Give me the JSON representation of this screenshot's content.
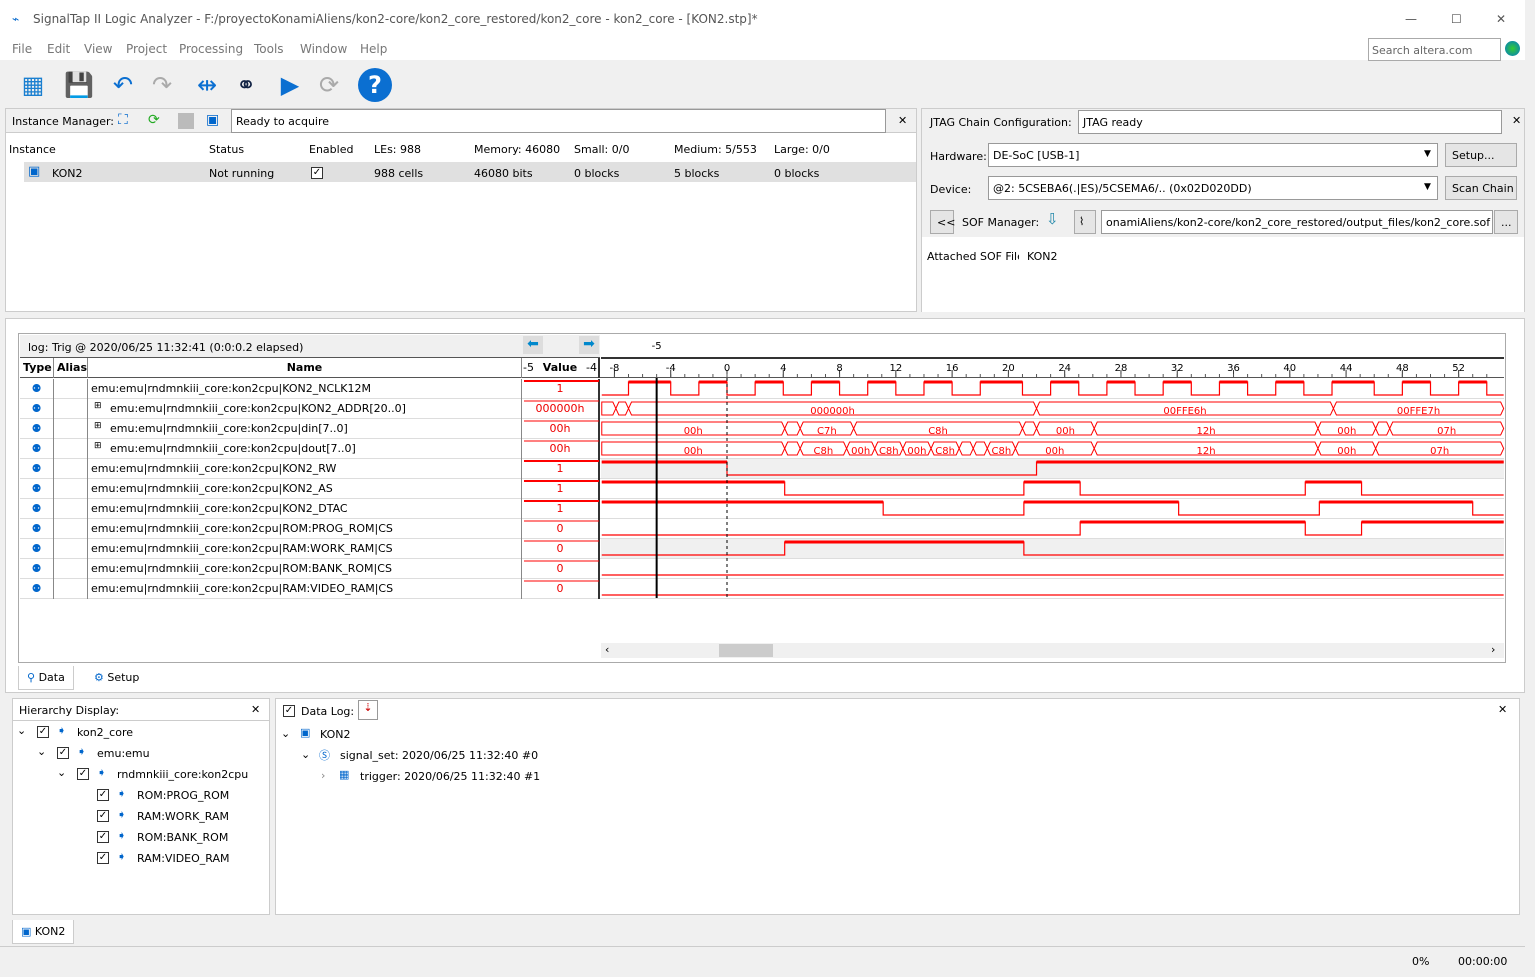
{
  "window": {
    "title": "SignalTap II Logic Analyzer - F:/proyectoKonamiAliens/kon2-core/kon2_core_restored/kon2_core - kon2_core - [KON2.stp]*",
    "minimize": "—",
    "maximize": "☐",
    "close": "✕"
  },
  "menu": [
    "File",
    "Edit",
    "View",
    "Project",
    "Processing",
    "Tools",
    "Window",
    "Help"
  ],
  "search": {
    "placeholder": "Search altera.com"
  },
  "toolbar": [
    "window-icon",
    "save-icon",
    "undo-icon",
    "redo-icon",
    "node-finder-icon",
    "binoculars-icon",
    "run-icon",
    "autorun-icon",
    "help-icon"
  ],
  "instance_manager": {
    "label": "Instance Manager:",
    "status": "Ready to acquire",
    "columns": [
      "Instance",
      "Status",
      "Enabled",
      "LEs: 988",
      "Memory: 46080",
      "Small: 0/0",
      "Medium: 5/553",
      "Large: 0/0"
    ],
    "rows": [
      {
        "instance": "KON2",
        "status": "Not running",
        "enabled": true,
        "les": "988 cells",
        "memory": "46080 bits",
        "small": "0 blocks",
        "medium": "5 blocks",
        "large": "0 blocks"
      }
    ]
  },
  "jtag": {
    "label": "JTAG Chain Configuration:",
    "status": "JTAG ready",
    "hardware_label": "Hardware:",
    "hardware": "DE-SoC [USB-1]",
    "setup": "Setup...",
    "device_label": "Device:",
    "device": "@2: 5CSEBA6(.|ES)/5CSEMA6/.. (0x02D020DD)",
    "scan": "Scan Chain",
    "back": "<<",
    "sof_label": "SOF Manager:",
    "sof_path": "onamiAliens/kon2-core/kon2_core_restored/output_files/kon2_core.sof",
    "browse": "...",
    "attached_label": "Attached SOF File:",
    "attached": "KON2"
  },
  "waveform": {
    "log": "log: Trig @ 2020/06/25 11:32:41 (0:0:0.2 elapsed)",
    "cursor_label": "-5",
    "cursor_time": -5,
    "columns": {
      "type": "Type",
      "alias": "Alias",
      "name": "Name",
      "value": "Value",
      "value_left": "-5",
      "value_right": "-4"
    },
    "ticks": [
      -8,
      -4,
      0,
      4,
      8,
      12,
      16,
      20,
      24,
      28,
      32,
      36,
      40,
      44,
      48,
      52
    ],
    "range": [
      -8.9,
      55.2
    ],
    "signals": [
      {
        "name": "emu:emu|rndmnkiii_core:kon2cpu|KON2_NCLK12M",
        "value": "1",
        "kind": "bit",
        "init": 0,
        "edges": [
          -7,
          -4,
          -2,
          0,
          2,
          4,
          6,
          8,
          10,
          12,
          14,
          16,
          18,
          21,
          23,
          25,
          27,
          29,
          31,
          33,
          35,
          37,
          39,
          41,
          43,
          46,
          48,
          50,
          52,
          54
        ]
      },
      {
        "name": "emu:emu|rndmnkiii_core:kon2cpu|KON2_ADDR[20..0]",
        "value": "000000h",
        "kind": "bus",
        "segs": [
          [
            -8.9,
            -7.9,
            ""
          ],
          [
            -7.9,
            -7,
            ""
          ],
          [
            -7,
            22,
            "000000h"
          ],
          [
            22,
            43.1,
            "00FFE6h"
          ],
          [
            43.1,
            55.2,
            "00FFE7h"
          ]
        ]
      },
      {
        "name": "emu:emu|rndmnkiii_core:kon2cpu|din[7..0]",
        "value": "00h",
        "kind": "bus",
        "segs": [
          [
            -8.9,
            4.1,
            "00h"
          ],
          [
            4.1,
            5.2,
            ""
          ],
          [
            5.2,
            9,
            "C7h"
          ],
          [
            9,
            21,
            "C8h"
          ],
          [
            21,
            22,
            ""
          ],
          [
            22,
            26.1,
            "00h"
          ],
          [
            26.1,
            42,
            "12h"
          ],
          [
            42,
            46.1,
            "00h"
          ],
          [
            46.1,
            47.1,
            ""
          ],
          [
            47.1,
            55.2,
            "07h"
          ]
        ]
      },
      {
        "name": "emu:emu|rndmnkiii_core:kon2cpu|dout[7..0]",
        "value": "00h",
        "kind": "bus",
        "segs": [
          [
            -8.9,
            4.1,
            "00h"
          ],
          [
            4.1,
            5.2,
            ""
          ],
          [
            5.2,
            8.5,
            "C8h"
          ],
          [
            8.5,
            10.5,
            "00h"
          ],
          [
            10.5,
            12.5,
            "C8h"
          ],
          [
            12.5,
            14.5,
            "00h"
          ],
          [
            14.5,
            16.5,
            "C8h"
          ],
          [
            16.5,
            17.5,
            ""
          ],
          [
            17.5,
            18.5,
            ""
          ],
          [
            18.5,
            20.5,
            "C8h"
          ],
          [
            20.5,
            26.1,
            "00h"
          ],
          [
            26.1,
            42,
            "12h"
          ],
          [
            42,
            46.1,
            "00h"
          ],
          [
            46.1,
            55.2,
            "07h"
          ]
        ]
      },
      {
        "name": "emu:emu|rndmnkiii_core:kon2cpu|KON2_RW",
        "value": "1",
        "kind": "bit",
        "init": 1,
        "edges": [
          0,
          22
        ],
        "shaded": true
      },
      {
        "name": "emu:emu|rndmnkiii_core:kon2cpu|KON2_AS",
        "value": "1",
        "kind": "bit",
        "init": 1,
        "edges": [
          4.1,
          21.1,
          25.1,
          41.1,
          45.1
        ]
      },
      {
        "name": "emu:emu|rndmnkiii_core:kon2cpu|KON2_DTAC",
        "value": "1",
        "kind": "bit",
        "init": 1,
        "edges": [
          11.1,
          21.1,
          32.1,
          42.1,
          53
        ]
      },
      {
        "name": "emu:emu|rndmnkiii_core:kon2cpu|ROM:PROG_ROM|CS",
        "value": "0",
        "kind": "bit",
        "init": 0,
        "edges": [
          25.1,
          41.1,
          45.1
        ]
      },
      {
        "name": "emu:emu|rndmnkiii_core:kon2cpu|RAM:WORK_RAM|CS",
        "value": "0",
        "kind": "bit",
        "init": 0,
        "edges": [
          4.1,
          21.1
        ],
        "shaded": true
      },
      {
        "name": "emu:emu|rndmnkiii_core:kon2cpu|ROM:BANK_ROM|CS",
        "value": "0",
        "kind": "bit",
        "init": 0,
        "edges": []
      },
      {
        "name": "emu:emu|rndmnkiii_core:kon2cpu|RAM:VIDEO_RAM|CS",
        "value": "0",
        "kind": "bit",
        "init": 0,
        "edges": []
      }
    ],
    "color": "#ff0000"
  },
  "tabs": [
    "Data",
    "Setup"
  ],
  "hierarchy": {
    "label": "Hierarchy Display:",
    "items": [
      "kon2_core",
      "emu:emu",
      "rndmnkiii_core:kon2cpu",
      "ROM:PROG_ROM",
      "RAM:WORK_RAM",
      "ROM:BANK_ROM",
      "RAM:VIDEO_RAM"
    ]
  },
  "datalog": {
    "label": "Data Log:",
    "root": "KON2",
    "signal_set": "signal_set: 2020/06/25 11:32:40  #0",
    "trigger": "trigger: 2020/06/25 11:32:40  #1"
  },
  "bottom_tab": "KON2",
  "status": {
    "progress": "0%",
    "time": "00:00:00"
  }
}
